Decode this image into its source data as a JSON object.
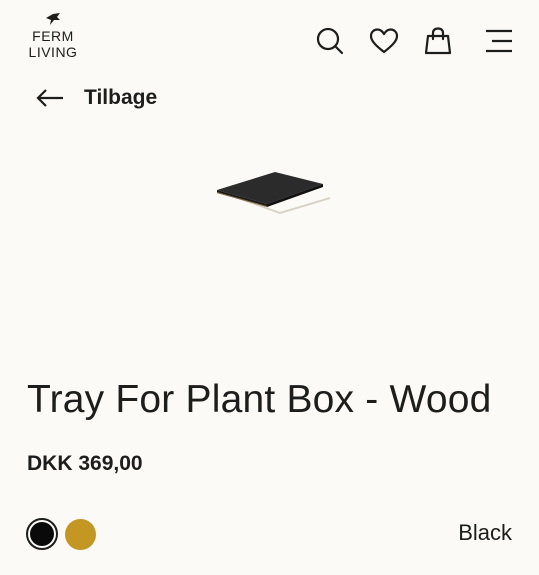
{
  "brand": {
    "line1": "FERM",
    "line2": "LIVING"
  },
  "header": {
    "icons": [
      "search-icon",
      "heart-icon",
      "bag-icon",
      "menu-icon"
    ]
  },
  "nav": {
    "back_label": "Tilbage"
  },
  "product": {
    "title": "Tray For Plant Box - Wood",
    "price": "DKK 369,00",
    "selected_color_name": "Black",
    "colors": [
      {
        "name": "Black",
        "hex": "#0a0a0a",
        "selected": true
      },
      {
        "name": "Gold",
        "hex": "#c49622",
        "selected": false
      }
    ]
  },
  "theme": {
    "background": "#fbfaf6",
    "text": "#1d1d1b"
  }
}
